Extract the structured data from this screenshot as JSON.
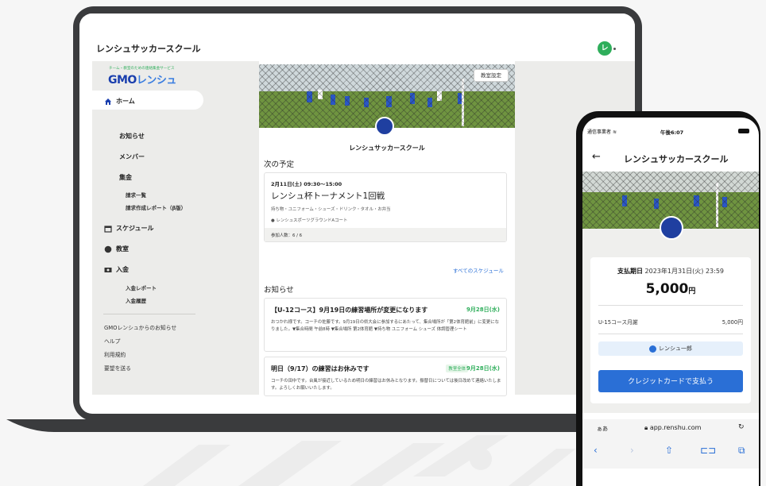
{
  "laptop": {
    "app_title": "レンシュサッカースクール",
    "avatar_letter": "レ",
    "brand": {
      "tagline": "チーム・教室のための連絡集金サービス",
      "gmo": "GMO",
      "renshu": "レンシュ"
    },
    "nav": {
      "home": "ホーム",
      "news": "お知らせ",
      "members": "メンバー",
      "billing": "集金",
      "billing_list": "請求一覧",
      "billing_report": "請求作成レポート（β版）",
      "schedule": "スケジュール",
      "classroom": "教室",
      "deposit": "入金",
      "deposit_report": "入金レポート",
      "deposit_history": "入金履歴"
    },
    "links": [
      "GMOレンシュからのお知らせ",
      "ヘルプ",
      "利用規約",
      "要望を送る"
    ],
    "settings_button": "教室設定",
    "team_name": "レンシュサッカースクール",
    "next_schedule_heading": "次の予定",
    "event": {
      "date": "2月11日(土) 09:30～15:00",
      "title": "レンシュ杯トーナメント1回戦",
      "items": "持ち物・ユニフォーム・シューズ・ドリンク・タオル・お弁当",
      "place": "レンシュスポーツグラウンドAコート",
      "participants": "参加人数：6 / 6"
    },
    "all_schedule_link": "すべてのスケジュール",
    "news_heading": "お知らせ",
    "news": [
      {
        "title": "【U-12コース】9月19日の練習場所が変更になります",
        "date": "9月28日(水)",
        "tag": "",
        "body": "おつかれ様です。コーチの佐藤です。9月19日の県大会に参加するにあたって、集合場所が「第2体育館前」に変更になりました。▼集合時間 午前8時 ▼集合場所 第2体育館 ▼持ち物 ユニフォーム シューズ 体調管理シート"
      },
      {
        "title": "明日（9/17）の練習はお休みです",
        "date": "9月28日(水)",
        "tag": "教室全体",
        "body": "コーチの田中です。台風が接近しているため明日の練習はお休みとなります。振替日については後日改めて連絡いたします。よろしくお願いいたします。"
      }
    ]
  },
  "phone": {
    "carrier": "通信事業者",
    "time": "午後6:07",
    "back": "←",
    "title": "レンシュサッカースクール",
    "payment": {
      "due_label": "支払期日",
      "due_date": "2023年1月31日(火) 23:59",
      "amount": "5,000",
      "currency": "円",
      "item_name": "U-15コース月謝",
      "item_price": "5,000円",
      "member": "レンシュ一郎",
      "pay_button": "クレジットカードで支払う"
    },
    "url": {
      "aa": "ぁあ",
      "address": "app.renshu.com",
      "reload": "↻"
    },
    "toolbar": {
      "back": "‹",
      "forward": "›",
      "share": "⇧",
      "bookmarks": "⊏⊐",
      "tabs": "⧉"
    }
  },
  "colors": {
    "accent_green": "#2fae5b",
    "brand_blue": "#1a3fae",
    "link_blue": "#2a6fd6",
    "team_badge": "#1f3fa0"
  }
}
